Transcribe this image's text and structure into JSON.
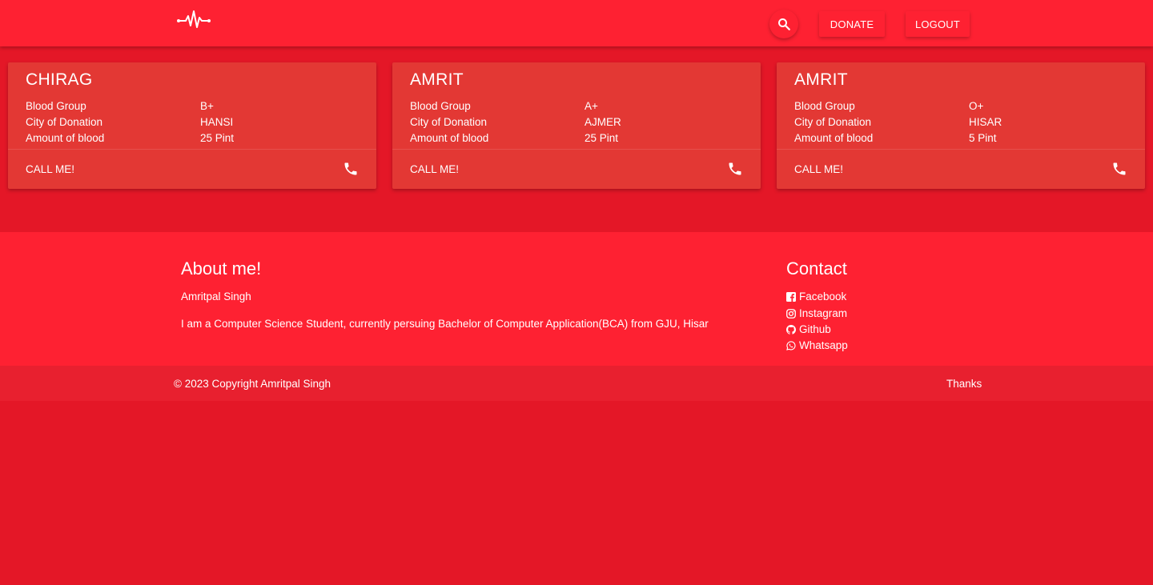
{
  "navbar": {
    "logo_icon": "heartbeat-icon",
    "search_icon": "search-icon",
    "donate_label": "DONATE",
    "logout_label": "LOGOUT"
  },
  "cards": [
    {
      "name": "CHIRAG",
      "blood_group_label": "Blood Group",
      "blood_group": "B+",
      "city_label": "City of Donation",
      "city": "HANSI",
      "amount_label": "Amount of blood",
      "amount": "25 Pint",
      "call_label": "CALL ME!",
      "phone_icon": "phone-icon"
    },
    {
      "name": "AMRIT",
      "blood_group_label": "Blood Group",
      "blood_group": "A+",
      "city_label": "City of Donation",
      "city": "AJMER",
      "amount_label": "Amount of blood",
      "amount": "25 Pint",
      "call_label": "CALL ME!",
      "phone_icon": "phone-icon"
    },
    {
      "name": "AMRIT",
      "blood_group_label": "Blood Group",
      "blood_group": "O+",
      "city_label": "City of Donation",
      "city": "HISAR",
      "amount_label": "Amount of blood",
      "amount": "5 Pint",
      "call_label": "CALL ME!",
      "phone_icon": "phone-icon"
    }
  ],
  "footer": {
    "about_title": "About me!",
    "about_name": "Amritpal Singh",
    "about_desc": "I am a Computer Science Student, currently persuing Bachelor of Computer Application(BCA) from GJU, Hisar",
    "contact_title": "Contact",
    "contacts": [
      {
        "label": "Facebook",
        "icon": "facebook-icon"
      },
      {
        "label": "Instagram",
        "icon": "instagram-icon"
      },
      {
        "label": "Github",
        "icon": "github-icon"
      },
      {
        "label": "Whatsapp",
        "icon": "whatsapp-icon"
      }
    ],
    "copyright": "© 2023 Copyright Amritpal Singh",
    "thanks": "Thanks"
  },
  "colors": {
    "background": "#e41727",
    "navbar": "#fe2132",
    "card": "#e33834",
    "copyright_bar": "#e8202f"
  }
}
